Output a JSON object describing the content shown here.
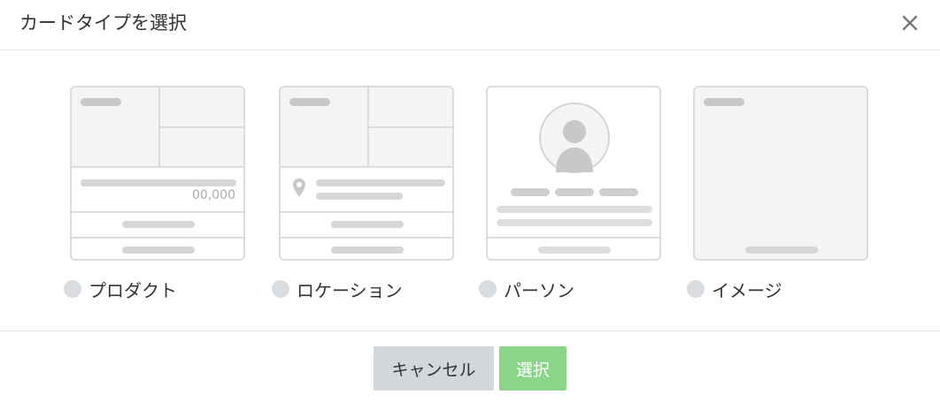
{
  "dialog": {
    "title": "カードタイプを選択",
    "close_icon": "close-icon"
  },
  "cards": {
    "product": {
      "label": "プロダクト",
      "price": "00,000"
    },
    "location": {
      "label": "ロケーション",
      "pin_icon": "map-pin-icon"
    },
    "person": {
      "label": "パーソン",
      "avatar_icon": "person-icon"
    },
    "image": {
      "label": "イメージ"
    }
  },
  "footer": {
    "cancel_label": "キャンセル",
    "select_label": "選択"
  },
  "colors": {
    "select_button": "#8bd58b",
    "cancel_button": "#d3d7dc",
    "placeholder": "#d6d6d6"
  }
}
